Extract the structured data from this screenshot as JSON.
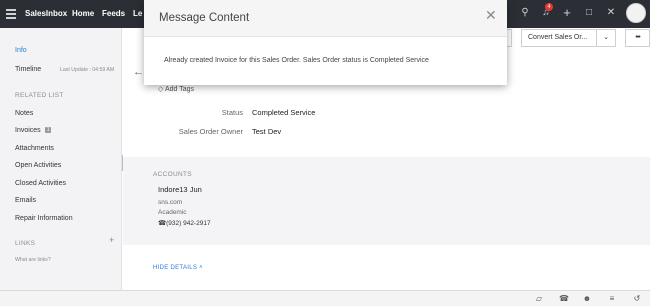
{
  "topbar": {
    "nav": [
      "SalesInbox",
      "Home",
      "Feeds",
      "Le"
    ],
    "notification_count": "4"
  },
  "sidebar": {
    "info": "Info",
    "timeline": "Timeline",
    "last_update": "Last Update : 04:59 AM",
    "related_list_heading": "RELATED LIST",
    "items": [
      {
        "label": "Notes"
      },
      {
        "label": "Invoices",
        "count": "1"
      },
      {
        "label": "Attachments"
      },
      {
        "label": "Open Activities"
      },
      {
        "label": "Closed Activities"
      },
      {
        "label": "Emails"
      },
      {
        "label": "Repair Information"
      }
    ],
    "links_heading": "LINKS",
    "links_help": "What are links?"
  },
  "header_buttons": {
    "partial": "t",
    "convert": "Convert Sales Or...",
    "more": "•••"
  },
  "record": {
    "add_tags": "Add Tags",
    "fields": [
      {
        "label": "Status",
        "value": "Completed Service"
      },
      {
        "label": "Sales Order Owner",
        "value": "Test Dev"
      }
    ]
  },
  "accounts": {
    "heading": "ACCOUNTS",
    "name": "Indore13 Jun",
    "website": "sns.com",
    "type": "Academic",
    "phone": "(932) 942-2917"
  },
  "hide_details": "HIDE DETAILS",
  "modal": {
    "title": "Message Content",
    "message": "Already created Invoice for this Sales Order. Sales Order status is Completed Service"
  }
}
